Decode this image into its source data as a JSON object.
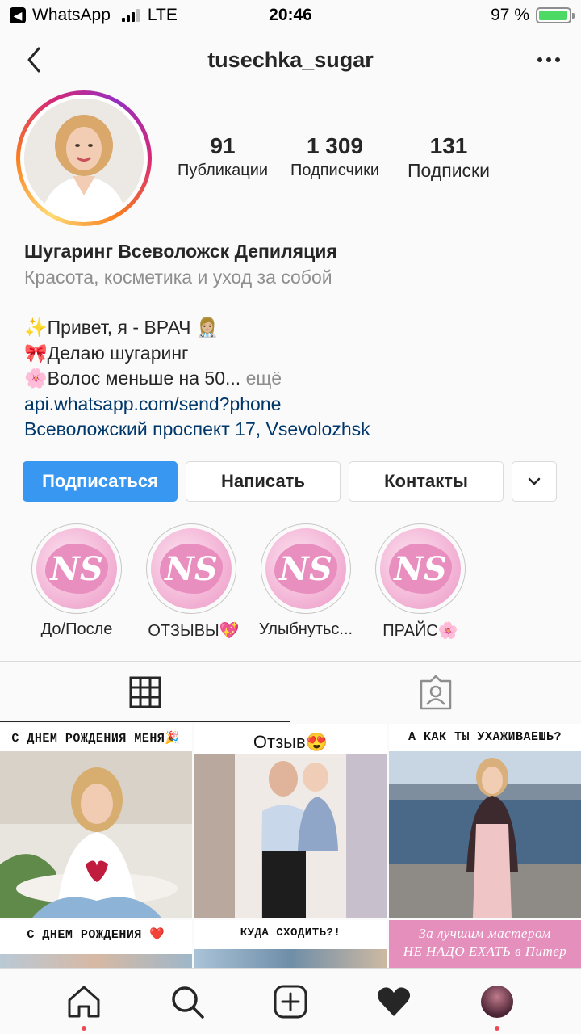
{
  "status_bar": {
    "back_app": "WhatsApp",
    "network": "LTE",
    "time": "20:46",
    "battery": "97 %",
    "battery_level": 0.97
  },
  "header": {
    "username": "tusechka_sugar"
  },
  "profile": {
    "stats": [
      {
        "value": "91",
        "label": "Публикации"
      },
      {
        "value": "1 309",
        "label": "Подписчики"
      },
      {
        "value": "131",
        "label": "Подписки"
      }
    ],
    "name": "Шугаринг Всеволожск Депиляция",
    "category": "Красота, косметика и уход за собой",
    "bio_lines": [
      "✨Привет, я - ВРАЧ 👩🏼‍⚕️",
      "🎀Делаю шугаринг",
      "🌸Волос меньше на 50..."
    ],
    "more": "ещё",
    "link": "api.whatsapp.com/send?phone",
    "address": "Всеволожский проспект 17, Vsevolozhsk"
  },
  "buttons": {
    "follow": "Подписаться",
    "message": "Написать",
    "contacts": "Контакты"
  },
  "highlights": [
    {
      "label": "До/После",
      "logo": "NS"
    },
    {
      "label": "ОТЗЫВЫ💖",
      "logo": "NS"
    },
    {
      "label": "Улыбнутьс...",
      "logo": "NS"
    },
    {
      "label": "ПРАЙС🌸",
      "logo": "NS"
    }
  ],
  "posts": [
    {
      "caption": "С ДНЕМ РОЖДЕНИЯ МЕНЯ🎉"
    },
    {
      "caption": "Отзыв😍"
    },
    {
      "caption": "А КАК ТЫ УХАЖИВАЕШЬ?"
    },
    {
      "caption": "С ДНЕМ РОЖДЕНИЯ ❤️"
    },
    {
      "caption": "КУДА СХОДИТЬ?!"
    },
    {
      "caption_line1": "За лучшим мастером",
      "caption_line2": "НЕ НАДО ЕХАТЬ в Питер"
    }
  ],
  "colors": {
    "accent": "#3897f0",
    "link": "#00376b",
    "notification": "#ed4956"
  }
}
